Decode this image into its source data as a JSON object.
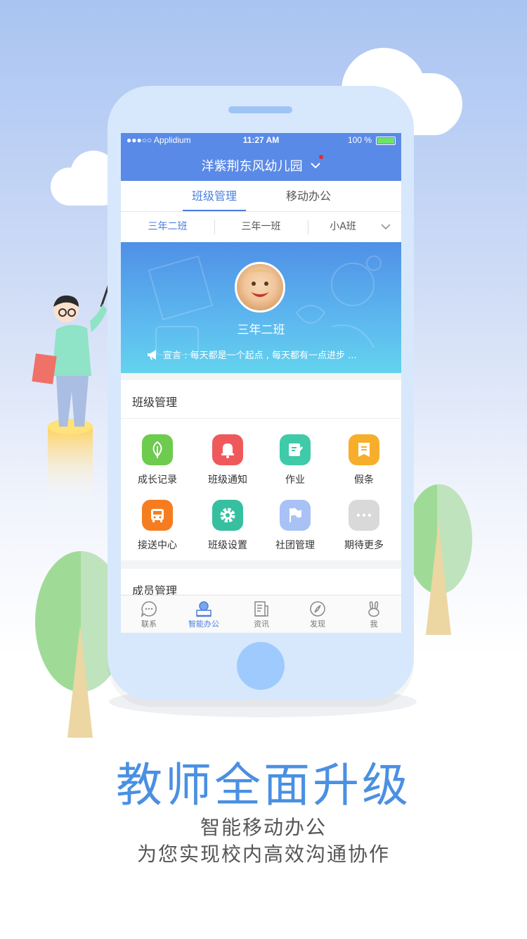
{
  "status_bar": {
    "carrier": "●●●○○ Applidium",
    "time": "11:27 AM",
    "battery": "100 %"
  },
  "nav": {
    "title": "洋紫荆东风幼儿园"
  },
  "tabs": [
    {
      "label": "班级管理"
    },
    {
      "label": "移动办公"
    }
  ],
  "classes": [
    {
      "label": "三年二班"
    },
    {
      "label": "三年一班"
    },
    {
      "label": "小A班"
    }
  ],
  "banner": {
    "class_name": "三年二班",
    "motto": "宣言 : 每天都是一个起点 , 每天都有一点进步 ..."
  },
  "class_management": {
    "title": "班级管理",
    "items": [
      {
        "label": "成长记录",
        "icon": "leaf-icon",
        "color": "#6dcb4e"
      },
      {
        "label": "班级通知",
        "icon": "bell-icon",
        "color": "#f0595b"
      },
      {
        "label": "作业",
        "icon": "edit-icon",
        "color": "#3fcaa9"
      },
      {
        "label": "假条",
        "icon": "note-icon",
        "color": "#f7ae2a"
      },
      {
        "label": "接送中心",
        "icon": "bus-icon",
        "color": "#f67d1f"
      },
      {
        "label": "班级设置",
        "icon": "gear-icon",
        "color": "#36c0a0"
      },
      {
        "label": "社团管理",
        "icon": "flag-icon",
        "color": "#a9c2f5"
      },
      {
        "label": "期待更多",
        "icon": "more-icon",
        "color": "#d9d9d9"
      }
    ]
  },
  "member_management": {
    "title": "成员管理"
  },
  "bottom_nav": [
    {
      "label": "联系",
      "icon": "chat-icon"
    },
    {
      "label": "智能办公",
      "icon": "office-icon"
    },
    {
      "label": "资讯",
      "icon": "news-icon"
    },
    {
      "label": "发现",
      "icon": "compass-icon"
    },
    {
      "label": "我",
      "icon": "rabbit-icon"
    }
  ],
  "promo": {
    "headline": "教师全面升级",
    "line1": "智能移动办公",
    "line2": "为您实现校内高效沟通协作"
  },
  "colors": {
    "brand": "#5a8ae7",
    "accent": "#4a7fe0",
    "headline": "#4a90e2"
  }
}
